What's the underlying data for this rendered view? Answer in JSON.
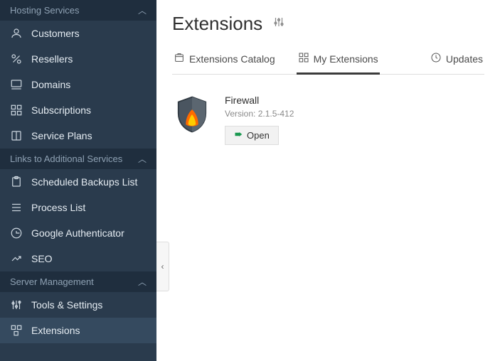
{
  "sidebar": {
    "sections": {
      "hosting": {
        "label": "Hosting Services"
      },
      "links": {
        "label": "Links to Additional Services"
      },
      "server": {
        "label": "Server Management"
      }
    },
    "items": {
      "customers": "Customers",
      "resellers": "Resellers",
      "domains": "Domains",
      "subscriptions": "Subscriptions",
      "servicePlans": "Service Plans",
      "scheduledBackups": "Scheduled Backups List",
      "processList": "Process List",
      "googleAuth": "Google Authenticator",
      "seo": "SEO",
      "toolsSettings": "Tools & Settings",
      "extensions": "Extensions"
    }
  },
  "page": {
    "title": "Extensions"
  },
  "tabs": {
    "catalog": "Extensions Catalog",
    "my": "My Extensions",
    "updates": "Updates"
  },
  "extension": {
    "name": "Firewall",
    "versionLabel": "Version: 2.1.5-412",
    "openLabel": "Open"
  }
}
